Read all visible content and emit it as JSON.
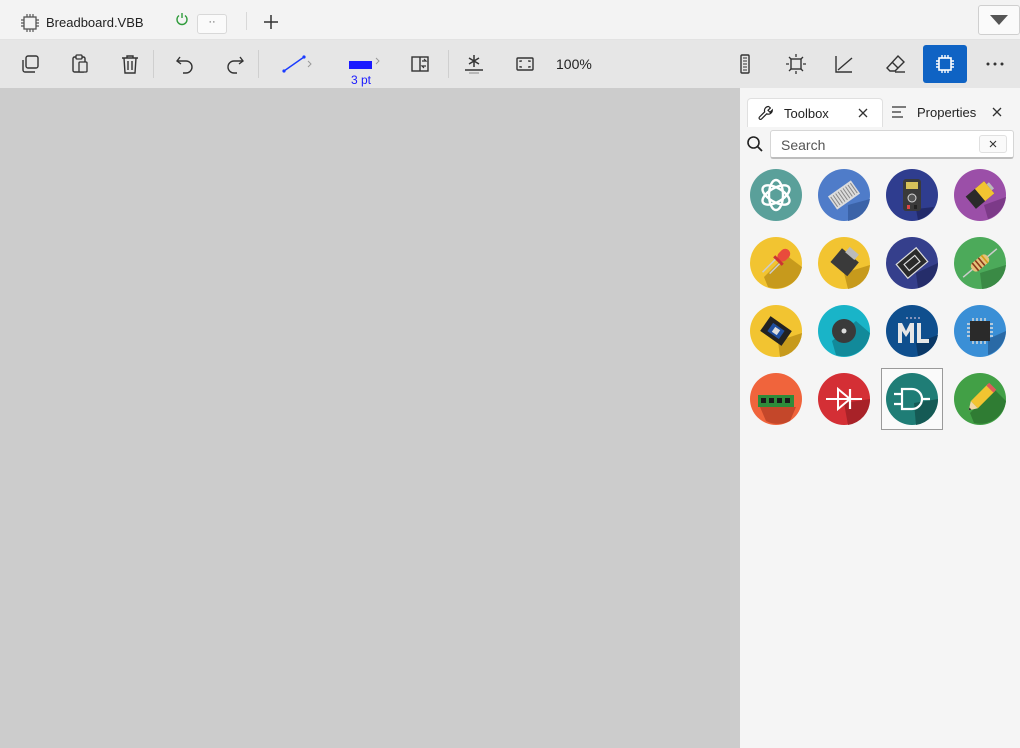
{
  "document": {
    "title": "Breadboard.VBB",
    "tab_more": "··"
  },
  "toolbar": {
    "stroke_width_label": "3 pt",
    "zoom_label": "100%",
    "colors": {
      "line": "#1a3bff",
      "stroke": "#1a1aff",
      "active": "#0f63c4"
    }
  },
  "panel": {
    "tabs": [
      {
        "label": "Toolbox",
        "icon": "wrench-icon",
        "active": true
      },
      {
        "label": "Properties",
        "icon": "properties-list-icon",
        "active": false
      }
    ],
    "search": {
      "placeholder": "Search",
      "value": ""
    },
    "toolbox_items": [
      {
        "icon": "openai-logo-icon",
        "bg": "#5aa09a"
      },
      {
        "icon": "ribbon-cable-icon",
        "bg": "#4f7cc9"
      },
      {
        "icon": "multimeter-icon",
        "bg": "#2f3d8f"
      },
      {
        "icon": "battery-icon",
        "bg": "#9b4fa8"
      },
      {
        "icon": "led-icon",
        "bg": "#f2c431"
      },
      {
        "icon": "potentiometer-icon",
        "bg": "#f2c431"
      },
      {
        "icon": "switch-icon",
        "bg": "#353f8c"
      },
      {
        "icon": "resistor-icon",
        "bg": "#4caa5a"
      },
      {
        "icon": "chip-module-icon",
        "bg": "#f2c431"
      },
      {
        "icon": "buzzer-icon",
        "bg": "#19b4c8"
      },
      {
        "icon": "tinyml-icon",
        "bg": "#0f4f8e"
      },
      {
        "icon": "microcontroller-icon",
        "bg": "#3a8fd6"
      },
      {
        "icon": "header-strip-icon",
        "bg": "#f0643c"
      },
      {
        "icon": "diode-icon",
        "bg": "#d42f35"
      },
      {
        "icon": "and-gate-icon",
        "bg": "#1f7d76"
      },
      {
        "icon": "pencil-icon",
        "bg": "#42a046"
      }
    ],
    "selected_item": "and-gate-icon"
  }
}
